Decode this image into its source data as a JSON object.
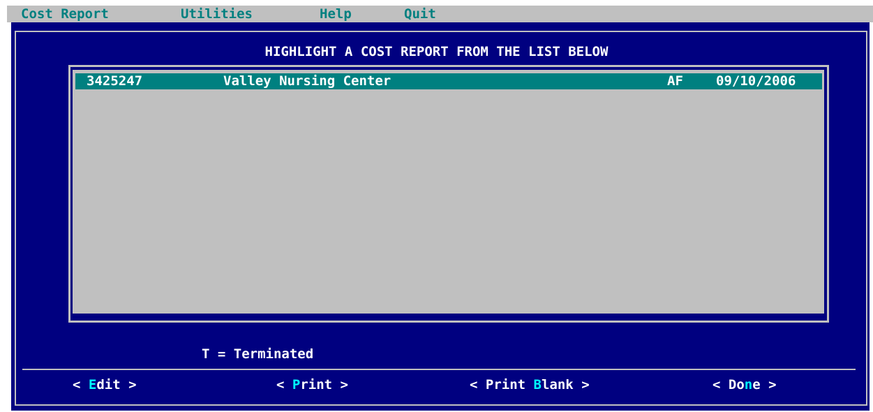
{
  "menubar": {
    "items": [
      {
        "label": "Cost Report"
      },
      {
        "label": "Utilities"
      },
      {
        "label": "Help"
      },
      {
        "label": "Quit"
      }
    ]
  },
  "main": {
    "title": "HIGHLIGHT A COST REPORT FROM THE LIST BELOW",
    "list": {
      "rows": [
        {
          "id": "3425247",
          "name": "Valley Nursing Center",
          "type": "AF",
          "date": "09/10/2006",
          "selected": true
        }
      ]
    },
    "legend": "T = Terminated"
  },
  "buttons": {
    "edit": {
      "open": "< ",
      "hotkey": "E",
      "rest": "dit",
      "close": " >"
    },
    "print": {
      "open": "< ",
      "hotkey": "P",
      "rest": "rint",
      "close": " >"
    },
    "print_blank": {
      "open": "< ",
      "pre": "Print ",
      "hotkey": "B",
      "rest": "lank",
      "close": " >"
    },
    "done": {
      "open": "< ",
      "pre": "Do",
      "hotkey": "n",
      "rest": "e",
      "close": " >"
    }
  },
  "colors": {
    "background": "#000080",
    "frame": "#c0c0c0",
    "highlight": "#008080",
    "text": "#ffffff",
    "hotkey": "#00ffff",
    "menu_text": "#008080"
  }
}
